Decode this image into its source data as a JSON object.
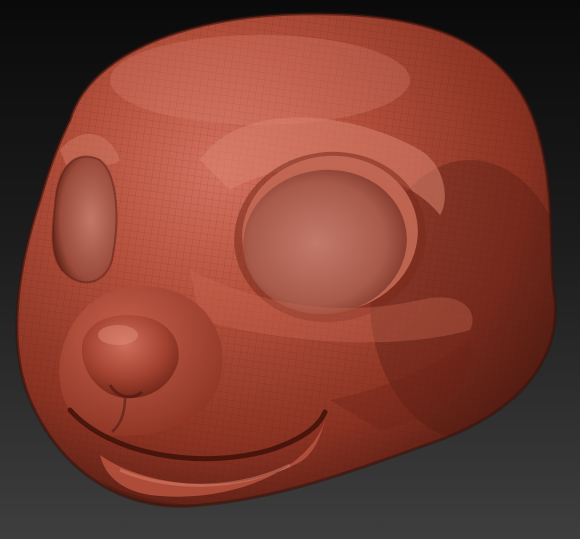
{
  "scene": {
    "subject": "sculpted-cartoon-animal-head",
    "colors": {
      "background_top": "#0a0a0a",
      "background_bottom": "#3e3e3e",
      "clay_base": "#a8412f",
      "clay_highlight": "#e08a76",
      "clay_shadow": "#5a1c12",
      "eye_socket": "#b86a5c",
      "wireframe": "#3a120c"
    }
  }
}
